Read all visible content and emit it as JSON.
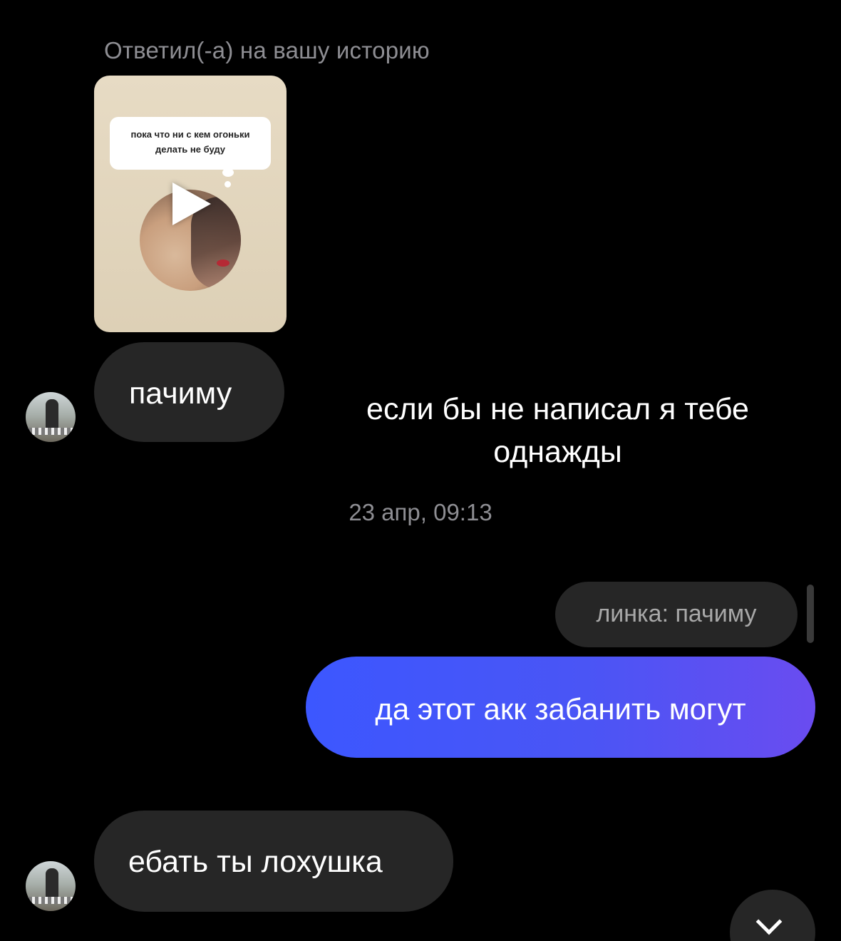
{
  "thread": {
    "story_reply_label": "Ответил(-а) на вашу историю",
    "story": {
      "caption": "пока что ни с кем огоньки делать не буду",
      "media_type": "video",
      "play_icon": "play-icon"
    },
    "overlay_text": "если бы не написал я тебе однажды",
    "timestamp": "23 апр, 09:13",
    "messages": [
      {
        "direction": "received",
        "text": "пачиму"
      },
      {
        "direction": "sent",
        "reply_to": "линка: пачиму",
        "text": "да этот акк забанить могут"
      },
      {
        "direction": "received",
        "text": "ебать ты лохушка"
      }
    ],
    "scroll_button_icon": "chevron-down-icon"
  },
  "colors": {
    "background": "#000000",
    "received_bubble": "#262626",
    "sent_bubble_start": "#3c57ff",
    "sent_bubble_end": "#6a4cf0",
    "secondary_text": "#8e8e93"
  }
}
